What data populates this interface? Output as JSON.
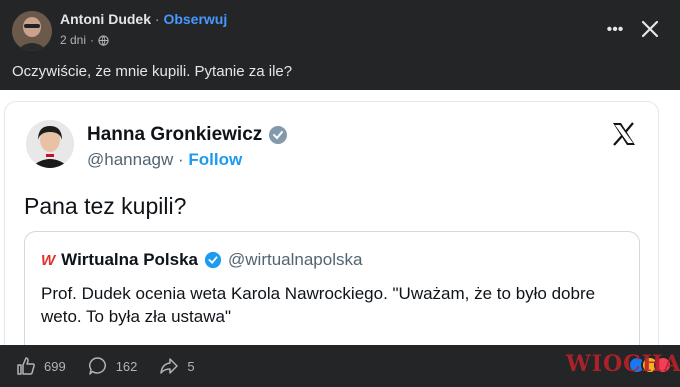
{
  "post": {
    "author": "Antoni Dudek",
    "separator": "·",
    "follow_label": "Obserwuj",
    "time": "2 dni",
    "meta_separator": "·",
    "privacy_icon": "globe-icon",
    "text": "Oczywiście, że mnie kupili. Pytanie za ile?"
  },
  "tweet": {
    "name": "Hanna Gronkiewicz",
    "handle": "@hannagw",
    "separator": "·",
    "follow_label": "Follow",
    "text": "Pana tez kupili?",
    "quote": {
      "logo_text": "W",
      "name": "Wirtualna Polska",
      "handle": "@wirtualnapolska",
      "text": "Prof. Dudek ocenia weta Karola Nawrockiego. \"Uważam, że to było dobre weto. To była zła ustawa\""
    }
  },
  "actions": {
    "likes": "699",
    "comments": "162",
    "shares": "5"
  },
  "watermark": "WIOCHA",
  "colors": {
    "facebook_bg": "#242526",
    "link_blue": "#4599ff",
    "twitter_blue": "#1d9bf0",
    "wp_red": "#e4302a"
  }
}
